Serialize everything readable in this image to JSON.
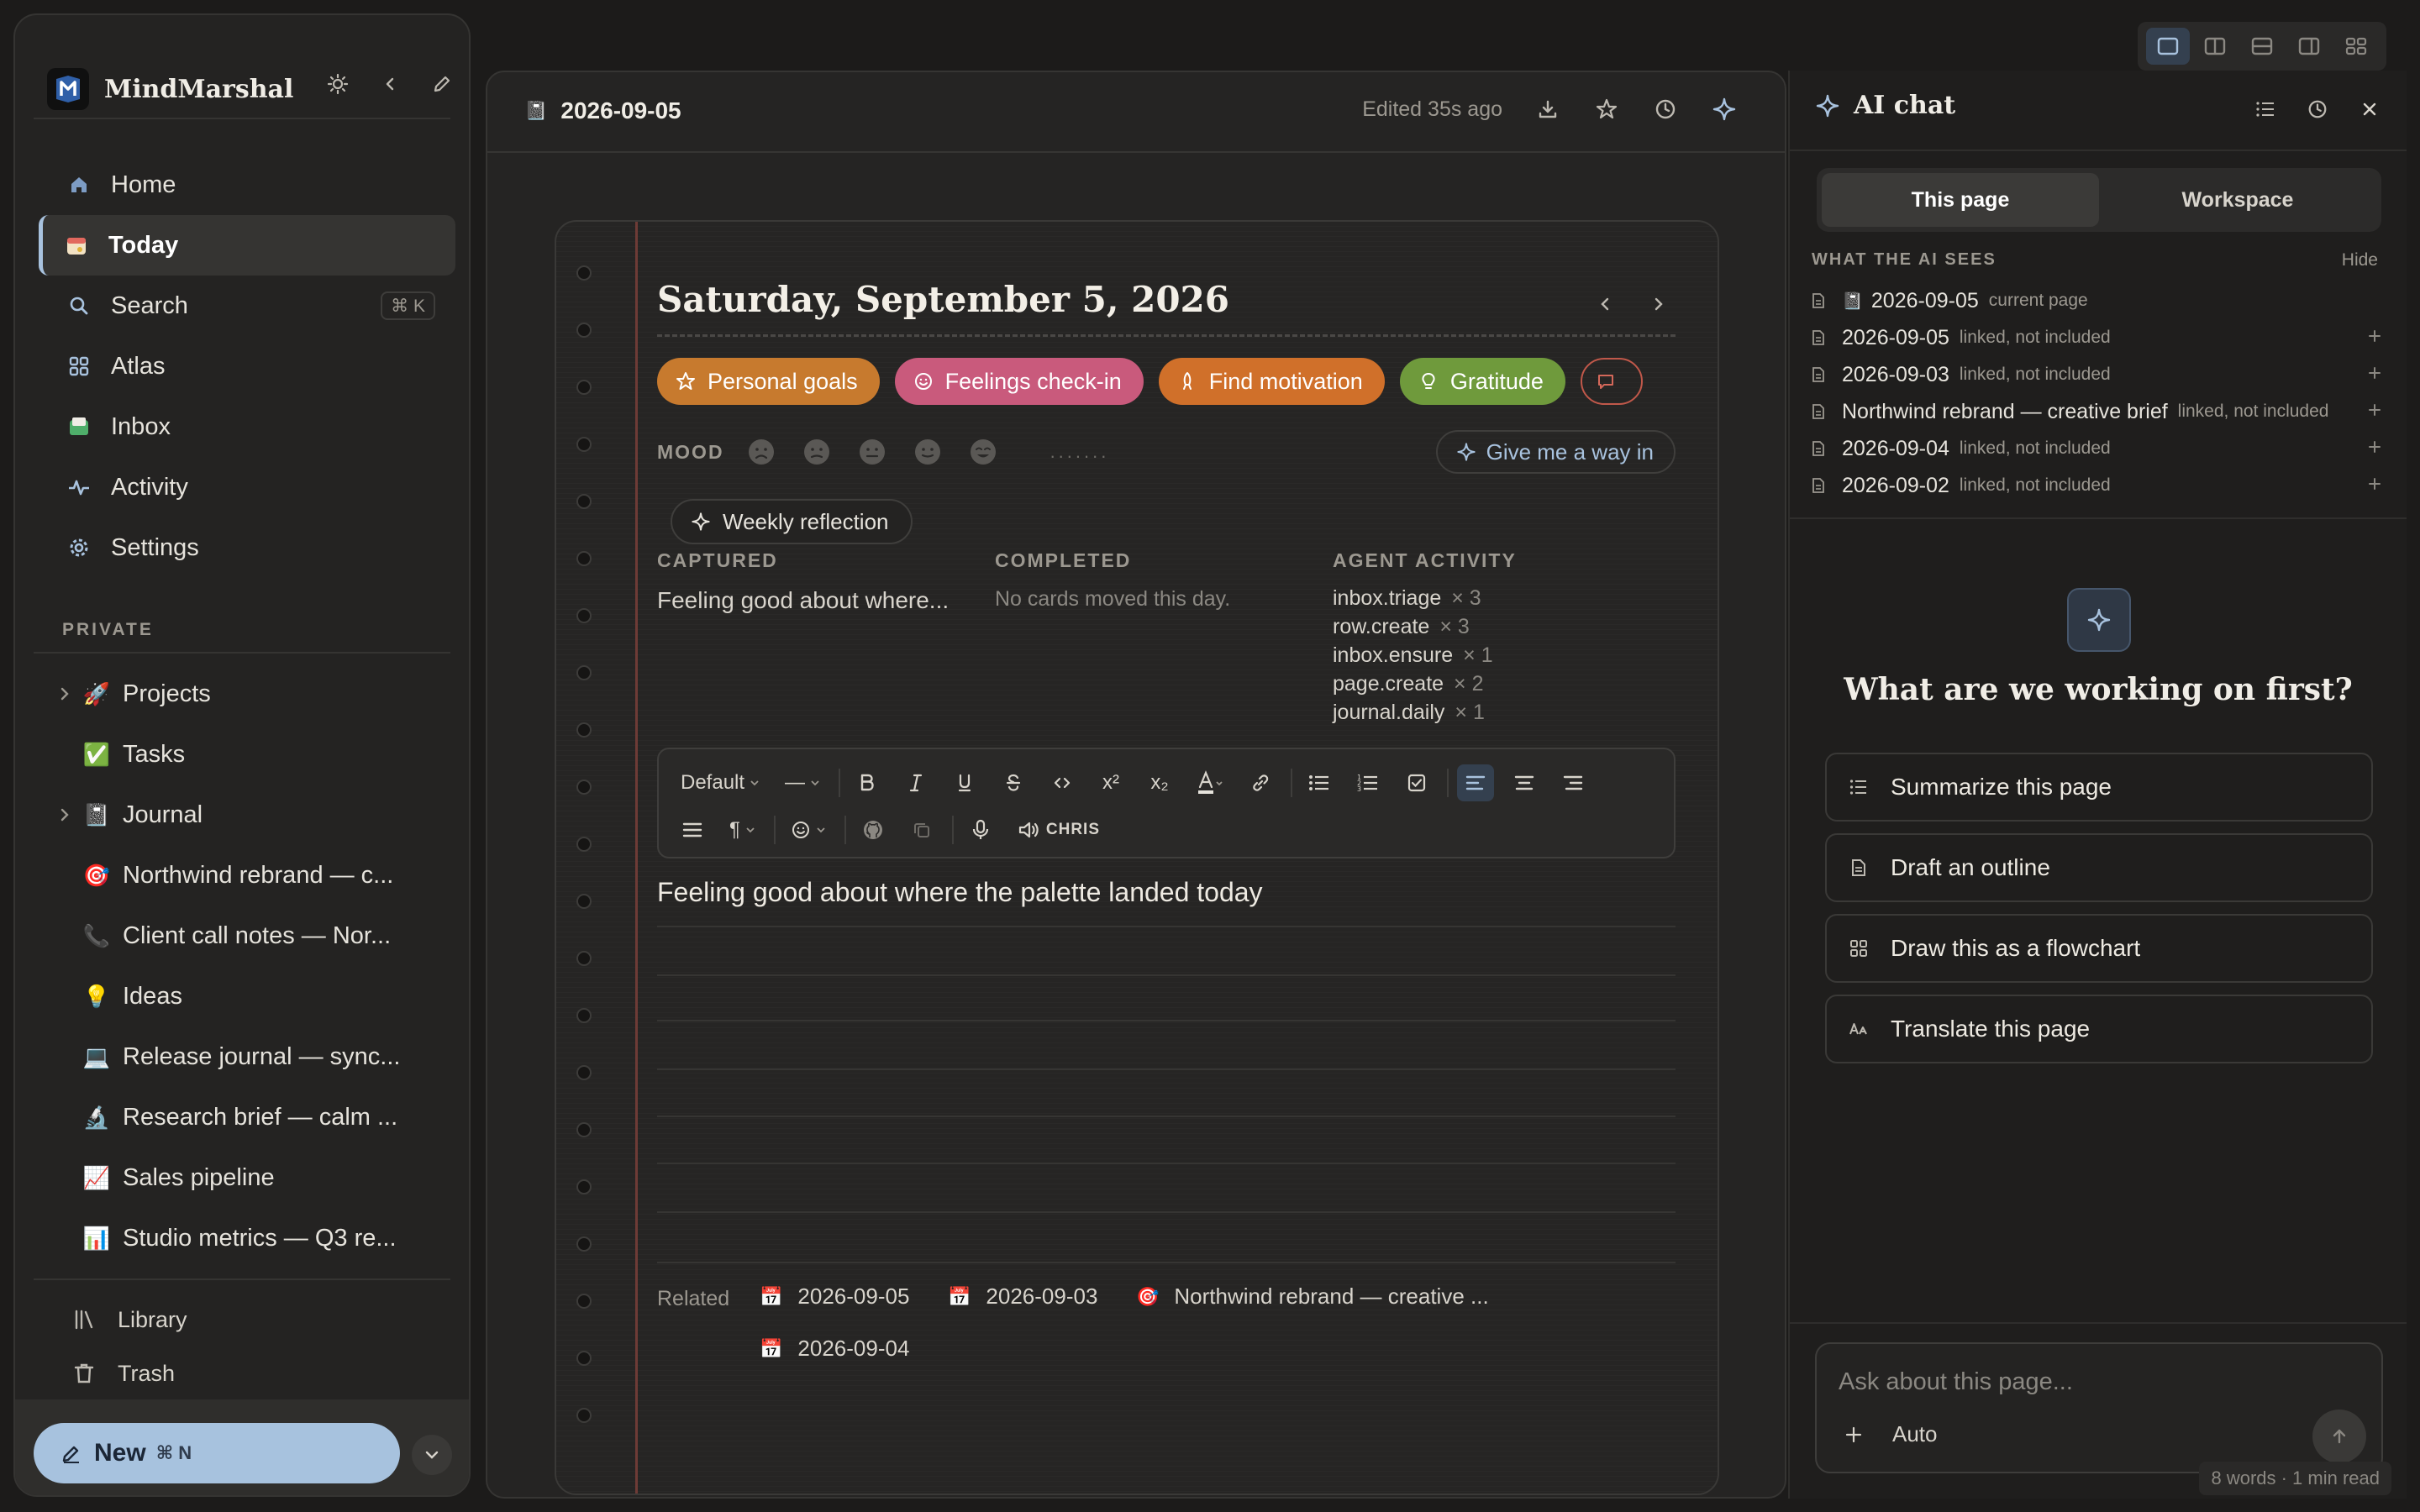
{
  "app": {
    "name": "MindMarshal"
  },
  "sidebar": {
    "nav": [
      {
        "label": "Home",
        "icon": "home-icon"
      },
      {
        "label": "Today",
        "icon": "calendar-icon"
      },
      {
        "label": "Search",
        "icon": "search-icon",
        "shortcut": "⌘ K"
      },
      {
        "label": "Atlas",
        "icon": "grid-icon"
      },
      {
        "label": "Inbox",
        "icon": "inbox-icon"
      },
      {
        "label": "Activity",
        "icon": "activity-icon"
      },
      {
        "label": "Settings",
        "icon": "gear-icon"
      }
    ],
    "active_nav": "Today",
    "section_private": "PRIVATE",
    "tree": [
      {
        "label": "Projects",
        "emoji": "🚀",
        "expandable": true
      },
      {
        "label": "Tasks",
        "emoji": "✅",
        "expandable": false
      },
      {
        "label": "Journal",
        "emoji": "📓",
        "expandable": true
      },
      {
        "label": "Northwind rebrand — c...",
        "emoji": "🎯",
        "expandable": false
      },
      {
        "label": "Client call notes — Nor...",
        "emoji": "📞",
        "expandable": false
      },
      {
        "label": "Ideas",
        "emoji": "💡",
        "expandable": false
      },
      {
        "label": "Release journal — sync...",
        "emoji": "💻",
        "expandable": false
      },
      {
        "label": "Research brief — calm ...",
        "emoji": "🔬",
        "expandable": false
      },
      {
        "label": "Sales pipeline",
        "emoji": "📈",
        "expandable": false
      },
      {
        "label": "Studio metrics — Q3 re...",
        "emoji": "📊",
        "expandable": false
      }
    ],
    "footer": [
      {
        "label": "Library",
        "icon": "library-icon"
      },
      {
        "label": "Trash",
        "icon": "trash-icon"
      }
    ],
    "new_button": {
      "label": "New",
      "shortcut": "⌘ N"
    }
  },
  "editor": {
    "page_title": "2026-09-05",
    "edited": "Edited 35s ago",
    "date_heading": "Saturday, September 5, 2026",
    "prompts": [
      {
        "label": "Personal goals",
        "color": "#c77a2e",
        "icon": "star-icon"
      },
      {
        "label": "Feelings check-in",
        "color": "#c95a7c",
        "icon": "smile-icon"
      },
      {
        "label": "Find motivation",
        "color": "#d0702a",
        "icon": "rocket-icon"
      },
      {
        "label": "Gratitude",
        "color": "#6f9a3c",
        "icon": "bulb-icon"
      }
    ],
    "mood_label": "MOOD",
    "mood_dots": ".......",
    "give_way": "Give me a way in",
    "weekly_reflection": "Weekly reflection",
    "captured": {
      "heading": "CAPTURED",
      "text": "Feeling good about where..."
    },
    "completed": {
      "heading": "COMPLETED",
      "text": "No cards moved this day."
    },
    "agent_activity": {
      "heading": "AGENT ACTIVITY",
      "items": [
        {
          "name": "inbox.triage",
          "count": "× 3"
        },
        {
          "name": "row.create",
          "count": "× 3"
        },
        {
          "name": "inbox.ensure",
          "count": "× 1"
        },
        {
          "name": "page.create",
          "count": "× 2"
        },
        {
          "name": "journal.daily",
          "count": "× 1"
        }
      ]
    },
    "toolbar": {
      "style": "Default",
      "divider": "—",
      "voice": "CHRIS"
    },
    "body": "Feeling good about where the palette landed today",
    "related_label": "Related",
    "related": [
      "2026-09-05",
      "2026-09-03",
      "Northwind rebrand — creative ...",
      "2026-09-04"
    ]
  },
  "ai_chat": {
    "title": "AI chat",
    "tabs": [
      "This page",
      "Workspace"
    ],
    "active_tab": "This page",
    "sees_heading": "WHAT THE AI SEES",
    "hide": "Hide",
    "context": [
      {
        "title": "2026-09-05",
        "note": "current page"
      },
      {
        "title": "2026-09-05",
        "note": "linked, not included"
      },
      {
        "title": "2026-09-03",
        "note": "linked, not included"
      },
      {
        "title": "Northwind rebrand — creative brief",
        "note": "linked, not included"
      },
      {
        "title": "2026-09-04",
        "note": "linked, not included"
      },
      {
        "title": "2026-09-02",
        "note": "linked, not included"
      }
    ],
    "question": "What are we working on first?",
    "suggestions": [
      {
        "label": "Summarize this page",
        "icon": "list-icon"
      },
      {
        "label": "Draft an outline",
        "icon": "document-icon"
      },
      {
        "label": "Draw this as a flowchart",
        "icon": "grid-icon"
      },
      {
        "label": "Translate this page",
        "icon": "translate-icon"
      }
    ],
    "input_placeholder": "Ask about this page...",
    "mode": "Auto",
    "word_count": "8 words · 1 min read"
  },
  "colors": {
    "accent": "#a8c2de",
    "background": "#1c1b1a",
    "panel": "#252423"
  }
}
